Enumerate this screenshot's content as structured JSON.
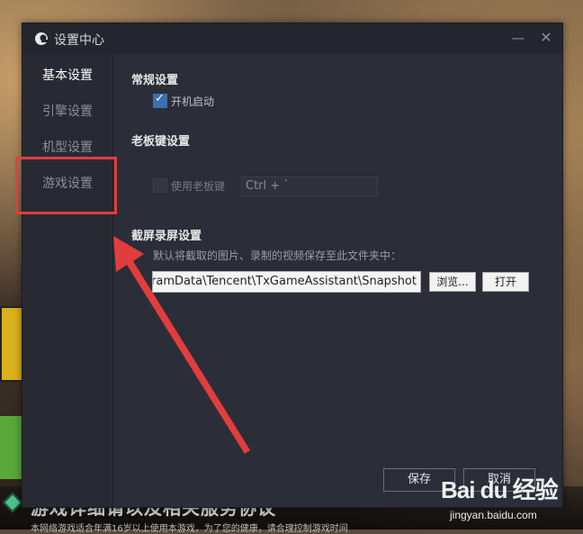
{
  "window": {
    "title": "设置中心",
    "minimize_symbol": "—",
    "close_symbol": "✕"
  },
  "sidebar": {
    "items": [
      {
        "label": "基本设置",
        "active": true
      },
      {
        "label": "引擎设置",
        "active": false
      },
      {
        "label": "机型设置",
        "active": false
      },
      {
        "label": "游戏设置",
        "active": false
      }
    ]
  },
  "general": {
    "title": "常规设置",
    "autostart_label": "开机启动",
    "autostart_checked": true
  },
  "bosskey": {
    "title": "老板键设置",
    "use_label": "使用老板键",
    "use_checked": false,
    "hotkey_value": "Ctrl + `"
  },
  "capture": {
    "title": "截屏录屏设置",
    "description": "默认将截取的图片、录制的视频保存至此文件夹中：",
    "path_value": "gramData\\Tencent\\TxGameAssistant\\Snapshot",
    "browse_label": "浏览...",
    "open_label": "打开"
  },
  "footer": {
    "save_label": "保存",
    "cancel_label": "取消"
  },
  "background": {
    "bottom_text": "游戏详细请以及相关服务协议",
    "bottom_small": "本网络游戏适合年满16岁以上使用本游戏，为了您的健康，请合理控制游戏时间"
  },
  "watermark": {
    "brand": "Bai du 经验",
    "url": "jingyan.baidu.com"
  },
  "colors": {
    "accent": "#3b6fb0",
    "annotation": "#e23d3d",
    "dialog_bg": "#2b2e38"
  }
}
